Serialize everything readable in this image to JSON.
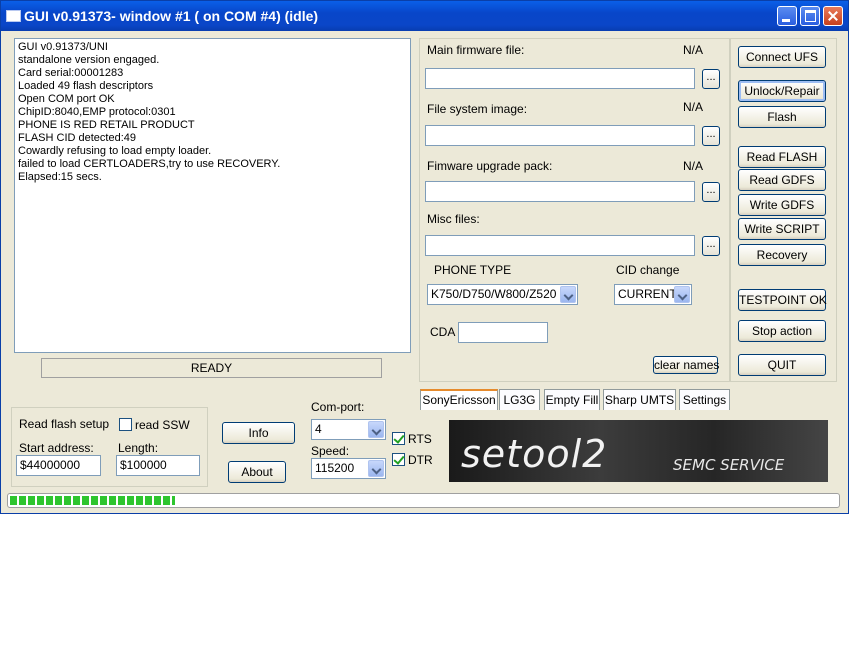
{
  "window": {
    "title": "GUI v0.91373- window #1 ( on COM #4) (idle)"
  },
  "log": [
    "GUI v0.91373/UNI",
    "standalone version engaged.",
    "Card serial:00001283",
    "Loaded 49 flash descriptors",
    "Open COM port OK",
    "ChipID:8040,EMP protocol:0301",
    "PHONE IS RED RETAIL PRODUCT",
    "FLASH CID detected:49",
    "Cowardly refusing to load empty loader.",
    "failed to load CERTLOADERS,try to use RECOVERY.",
    "Elapsed:15 secs."
  ],
  "status": "READY",
  "files": {
    "main_firmware_label": "Main firmware file:",
    "main_firmware_status": "N/A",
    "main_firmware_value": "",
    "fs_image_label": "File system image:",
    "fs_image_status": "N/A",
    "fs_image_value": "",
    "upgrade_pack_label": "Fimware upgrade pack:",
    "upgrade_pack_status": "N/A",
    "upgrade_pack_value": "",
    "misc_label": "Misc files:",
    "misc_value": "",
    "browse_label": "..."
  },
  "phone": {
    "type_label": "PHONE TYPE",
    "type_value": "K750/D750/W800/Z520",
    "cid_label": "CID change",
    "cid_value": "CURRENT",
    "cda_label": "CDA",
    "cda_value": "",
    "clear_names": "clear names"
  },
  "actions": {
    "connect": "Connect UFS",
    "unlock": "Unlock/Repair",
    "flash": "Flash",
    "read_flash": "Read FLASH",
    "read_gdfs": "Read GDFS",
    "write_gdfs": "Write GDFS",
    "write_script": "Write SCRIPT",
    "recovery": "Recovery",
    "testpoint": "TESTPOINT OK",
    "stop": "Stop action",
    "quit": "QUIT"
  },
  "read_setup": {
    "title": "Read flash setup",
    "read_ssw": "read SSW",
    "start_label": "Start address:",
    "start_value": "$44000000",
    "length_label": "Length:",
    "length_value": "$100000"
  },
  "misc_buttons": {
    "info": "Info",
    "about": "About"
  },
  "com": {
    "port_label": "Com-port:",
    "port_value": "4",
    "speed_label": "Speed:",
    "speed_value": "115200",
    "rts": "RTS",
    "dtr": "DTR",
    "rts_checked": true,
    "dtr_checked": true
  },
  "tabs": [
    "SonyEricsson",
    "LG3G",
    "Empty Fill",
    "Sharp UMTS",
    "Settings"
  ],
  "banner": {
    "logo": "setool2",
    "sub": "SEMC SERVICE"
  },
  "progress": {
    "fraction": 0.2
  }
}
